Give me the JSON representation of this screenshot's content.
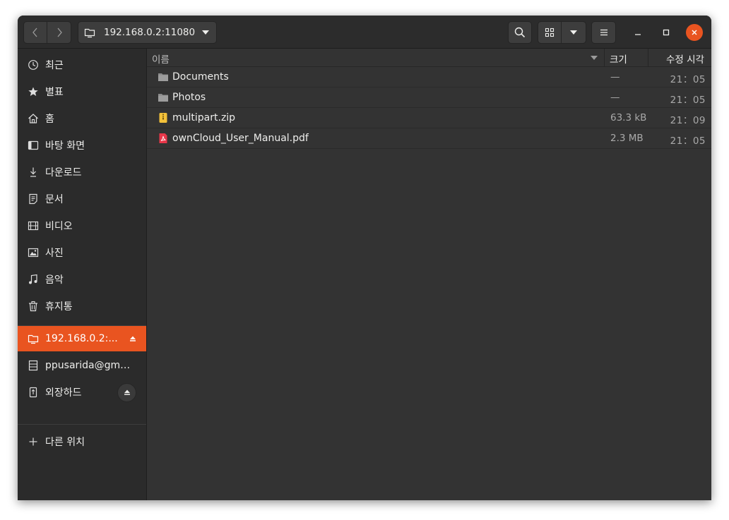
{
  "header": {
    "location": "192.168.0.2:11080",
    "icons": [
      "back-icon",
      "forward-icon",
      "folder-remote-icon",
      "search-icon",
      "grid-view-icon",
      "view-options-icon",
      "hamburger-menu-icon",
      "minimize-icon",
      "maximize-icon",
      "close-icon"
    ]
  },
  "sidebar": {
    "places": [
      {
        "label": "최근",
        "icon": "clock-icon"
      },
      {
        "label": "별표",
        "icon": "star-icon"
      },
      {
        "label": "홈",
        "icon": "home-icon"
      },
      {
        "label": "바탕 화면",
        "icon": "desktop-icon"
      },
      {
        "label": "다운로드",
        "icon": "download-icon"
      },
      {
        "label": "문서",
        "icon": "document-icon"
      },
      {
        "label": "비디오",
        "icon": "video-icon"
      },
      {
        "label": "사진",
        "icon": "picture-icon"
      },
      {
        "label": "음악",
        "icon": "music-icon"
      },
      {
        "label": "휴지통",
        "icon": "trash-icon"
      }
    ],
    "devices": [
      {
        "label": "192.168.0.2:...",
        "icon": "network-folder-icon",
        "active": true
      },
      {
        "label": "ppusarida@gma...",
        "icon": "server-icon"
      },
      {
        "label": "외장하드",
        "icon": "usb-drive-icon"
      }
    ],
    "other_locations": {
      "label": "다른 위치",
      "icon": "plus-icon"
    }
  },
  "columns": {
    "name": "이름",
    "size": "크기",
    "modified": "수정 시각"
  },
  "files": [
    {
      "name": "Documents",
      "size": "—",
      "modified": "21：05",
      "type": "folder"
    },
    {
      "name": "Photos",
      "size": "—",
      "modified": "21：05",
      "type": "folder"
    },
    {
      "name": "multipart.zip",
      "size": "63.3 kB",
      "modified": "21：09",
      "type": "archive"
    },
    {
      "name": "ownCloud_User_Manual.pdf",
      "size": "2.3 MB",
      "modified": "21：05",
      "type": "pdf"
    }
  ],
  "colors": {
    "accent": "#e95420",
    "window_bg": "#333333",
    "sidebar_bg": "#2b2b2b",
    "header_bg": "#2c2c2c"
  }
}
